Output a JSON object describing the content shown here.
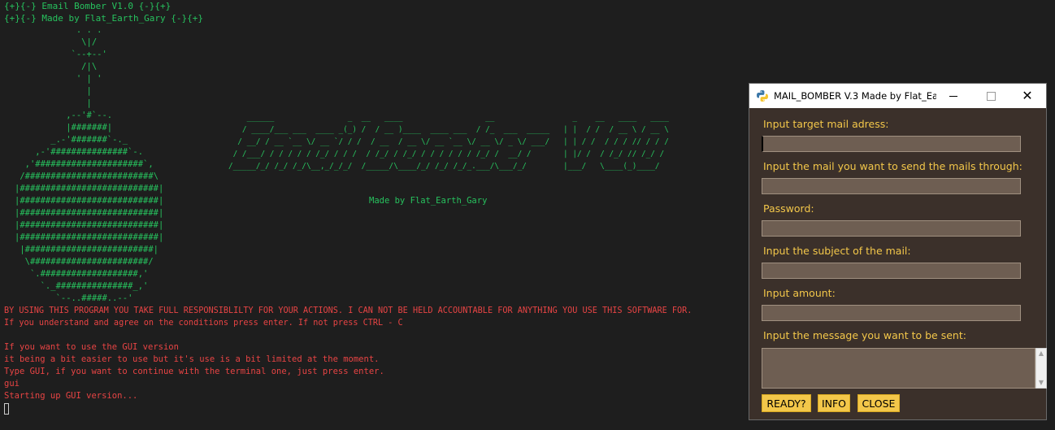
{
  "terminal": {
    "header_line1": "{+}{-} Email Bomber V1.0 {-}{+}",
    "header_line2": "{+}{-} Made by Flat_Earth_Gary {-}{+}",
    "bomb_art": "            . . .\n             \\|/\n           `--+--'\n             /|\\\n            ' | '\n              |\n              |\n          ,--'#`--.\n          |#######|\n       _.-'#######`-._\n    ,-'###############`-.\n  ,'#####################`,\n /#########################\\\n|###########################|\n|###########################|\n|###########################|\n|###########################|\n|###########################|\n |#########################|\n  \\#######################/\n   `.###################,'\n     `._###############_,'\n        `--..#####..--'",
    "title_art": "    ______                _  __   ____                  __                 _    __   ____   ____\n   / ____/___ ___  ____ _(_) /  / __ )____  ____ ___  / /_  ___  _____   | |  / /  / __ \\ / __ \\\n  / __/ / __ `__ \\/ __ `/ / /  / __  / __ \\/ __ `__ \\/ __ \\/ _ \\/ ___/   | | / /  / / / // / / /\n / /___/ / / / / / /_/ / / /  / /_/ / /_/ / / / / / / /_/ /  __/ /       | |/ /  / /_/ // /_/ /\n/_____/_/ /_/ /_/\\__,_/_/_/  /_____/\\____/_/ /_/ /_/_.___/\\___/_/        |___/   \\____(_)____/",
    "art_credit": "Made by Flat_Earth_Gary",
    "disclaimer": "BY USING THIS PROGRAM YOU TAKE FULL RESPONSIBLILTY FOR YOUR ACTIONS. I CAN NOT BE HELD ACCOUNTABLE FOR ANYTHING YOU USE THIS SOFTWARE FOR.",
    "agree_prompt": "If you understand and agree on the conditions press enter. If not press CTRL - C",
    "gui_info1": "If you want to use the GUI version",
    "gui_info2": "it being a bit easier to use but it's use is a bit limited at the moment.",
    "gui_info3": "Type GUI, if you want to continue with the terminal one, just press enter.",
    "user_input": "gui",
    "startup_msg": "Starting up GUI version..."
  },
  "window": {
    "title": "MAIL_BOMBER V.3 Made by Flat_Ea...",
    "icon": "python-icon"
  },
  "form": {
    "target_label": "Input target mail adress:",
    "target_value": "",
    "sender_label": "Input the mail you want to send the mails through:",
    "sender_value": "",
    "password_label": "Password:",
    "password_value": "",
    "subject_label": "Input the subject of the mail:",
    "subject_value": "",
    "amount_label": "Input amount:",
    "amount_value": "",
    "message_label": "Input the message you want to be sent:",
    "message_value": ""
  },
  "buttons": {
    "ready": "READY?",
    "info": "INFO",
    "close": "CLOSE"
  },
  "colors": {
    "terminal_bg": "#1e1e1e",
    "terminal_green": "#27c25e",
    "terminal_red": "#e84444",
    "gui_bg": "#3b302a",
    "gui_label": "#f3c74a",
    "gui_input_bg": "#6e5e52",
    "gui_button": "#f3c74a"
  }
}
